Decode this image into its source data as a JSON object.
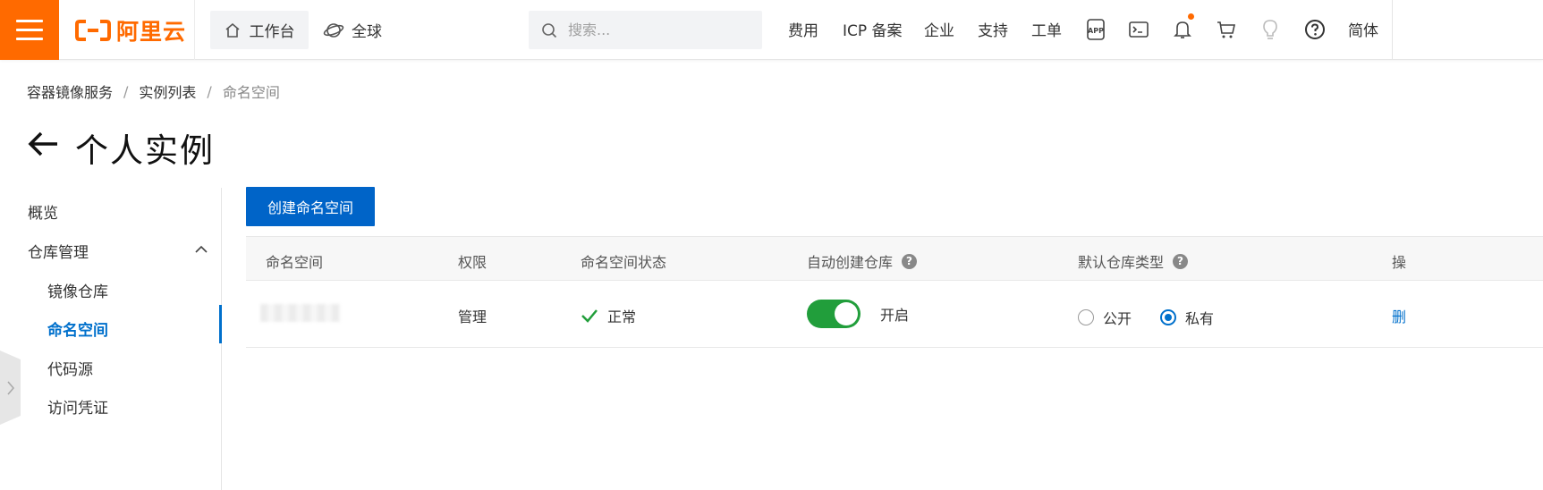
{
  "topbar": {
    "logo_text": "阿里云",
    "workbench": "工作台",
    "global": "全球",
    "search_placeholder": "搜索...",
    "nav": {
      "fee": "费用",
      "icp": "ICP 备案",
      "enterprise": "企业",
      "support": "支持",
      "ticket": "工单",
      "lang": "简体"
    },
    "brand_color": "#ff6a00"
  },
  "breadcrumb": {
    "items": [
      "容器镜像服务",
      "实例列表",
      "命名空间"
    ],
    "separator": "/"
  },
  "page": {
    "title": "个人实例"
  },
  "sidebar": {
    "overview": "概览",
    "repo_management": "仓库管理",
    "items": [
      "镜像仓库",
      "命名空间",
      "代码源",
      "访问凭证"
    ],
    "active_index": 1
  },
  "main": {
    "create_button": "创建命名空间",
    "table": {
      "headers": [
        "命名空间",
        "权限",
        "命名空间状态",
        "自动创建仓库",
        "默认仓库类型",
        "操"
      ],
      "rows": [
        {
          "permission": "管理",
          "status": "正常",
          "auto_create_label": "开启",
          "auto_create_on": true,
          "repo_type_options": [
            "公开",
            "私有"
          ],
          "repo_type_selected": "私有",
          "action": "删"
        }
      ]
    },
    "accent_color": "#0070cc",
    "toggle_color": "#219e3b"
  }
}
